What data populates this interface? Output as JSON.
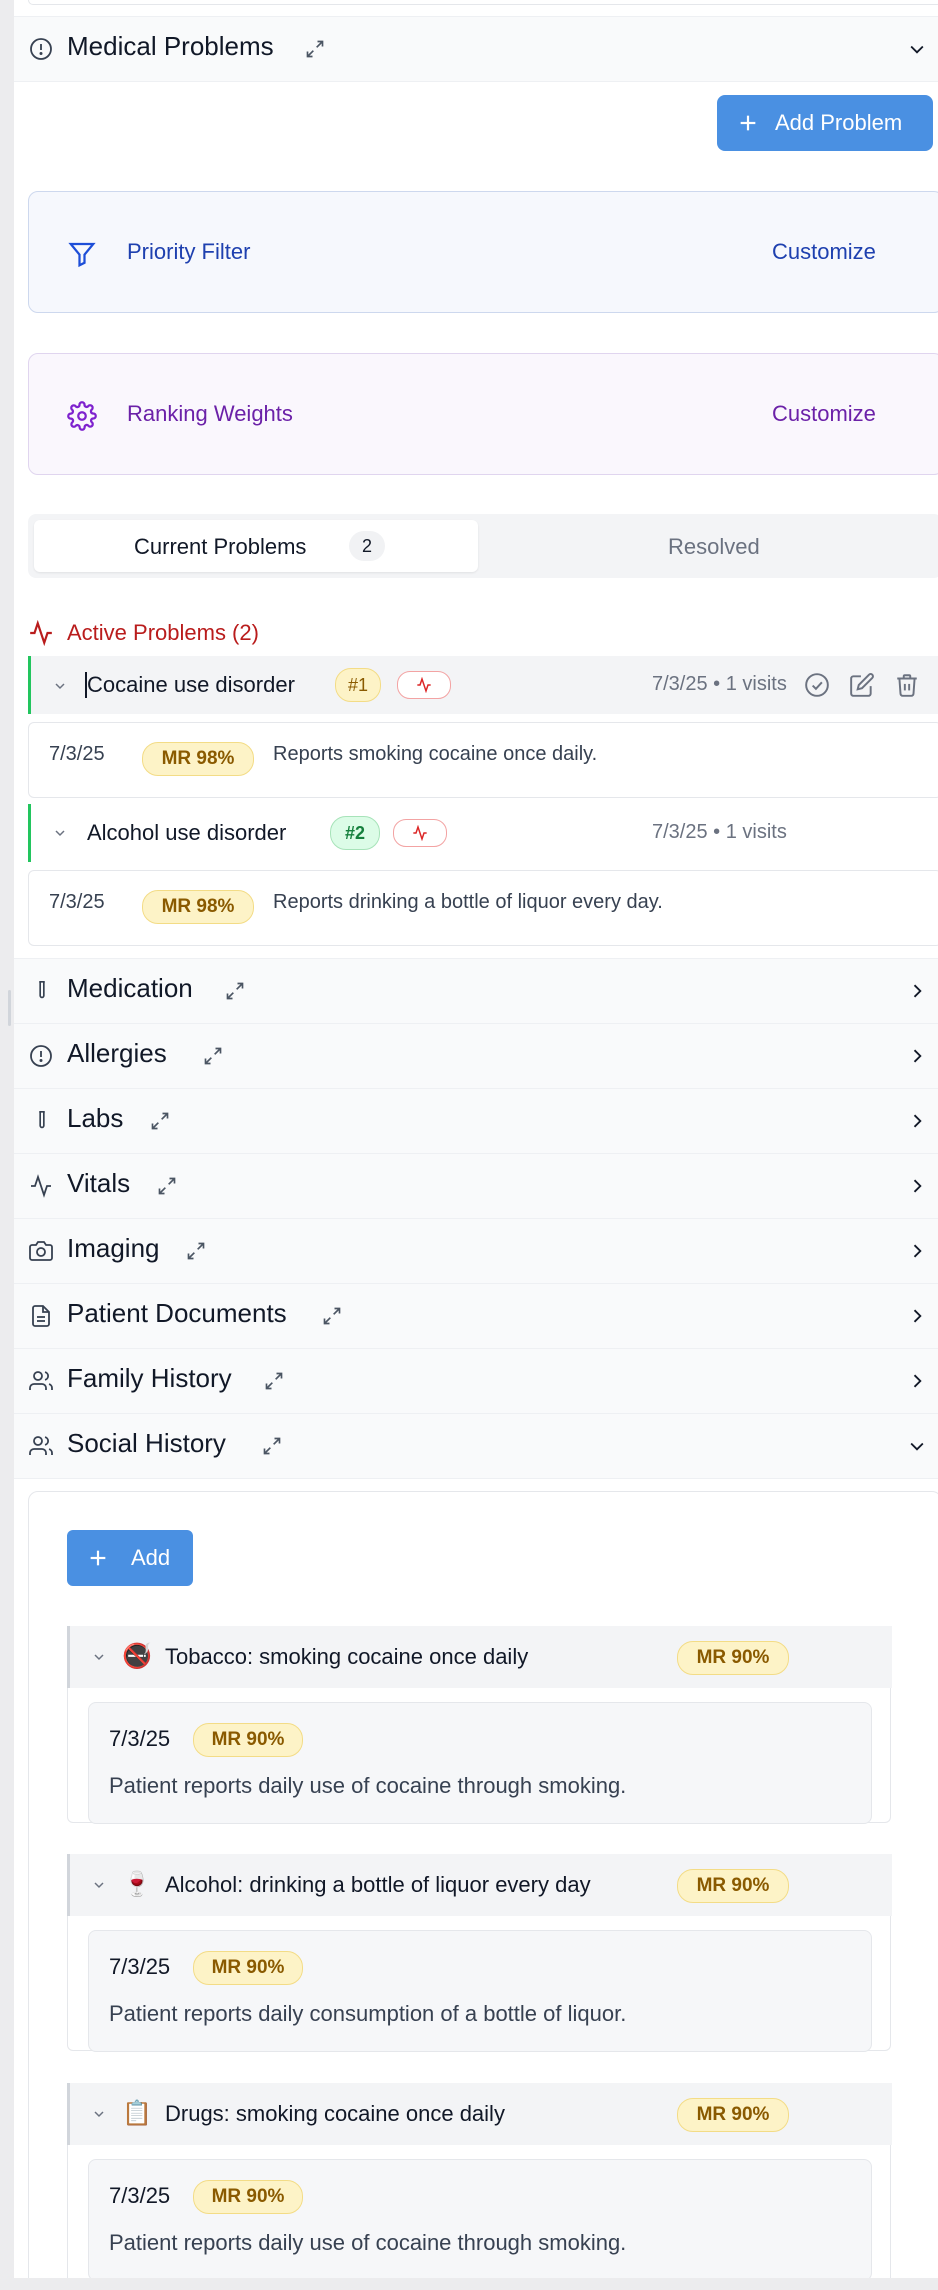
{
  "medical_problems": {
    "title": "Medical Problems",
    "add_problem_label": "Add Problem",
    "priority_filter": {
      "label": "Priority Filter",
      "action": "Customize"
    },
    "ranking_weights": {
      "label": "Ranking Weights",
      "action": "Customize"
    },
    "tabs": {
      "current_label": "Current Problems",
      "current_count": "2",
      "resolved_label": "Resolved"
    },
    "active_header": "Active Problems (2)",
    "problems": [
      {
        "name": "Cocaine use disorder",
        "rank": "#1",
        "meta": "7/3/25 • 1 visits",
        "entry": {
          "date": "7/3/25",
          "badge": "MR 98%",
          "text": "Reports smoking cocaine once daily."
        }
      },
      {
        "name": "Alcohol use disorder",
        "rank": "#2",
        "meta": "7/3/25 • 1 visits",
        "entry": {
          "date": "7/3/25",
          "badge": "MR 98%",
          "text": "Reports drinking a bottle of liquor every day."
        }
      }
    ]
  },
  "sections": [
    {
      "title": "Medication",
      "icon": "test-tube-icon"
    },
    {
      "title": "Allergies",
      "icon": "alert-circle-icon"
    },
    {
      "title": "Labs",
      "icon": "test-tube-icon"
    },
    {
      "title": "Vitals",
      "icon": "activity-icon"
    },
    {
      "title": "Imaging",
      "icon": "camera-icon"
    },
    {
      "title": "Patient Documents",
      "icon": "document-icon"
    },
    {
      "title": "Family History",
      "icon": "users-icon"
    }
  ],
  "social_history": {
    "title": "Social History",
    "add_label": "Add",
    "items": [
      {
        "emoji": "🚭",
        "title": "Tobacco: smoking cocaine once daily",
        "badge": "MR 90%",
        "entry": {
          "date": "7/3/25",
          "badge": "MR 90%",
          "text": "Patient reports daily use of cocaine through smoking."
        }
      },
      {
        "emoji": "🍷",
        "title": "Alcohol: drinking a bottle of liquor every day",
        "badge": "MR 90%",
        "entry": {
          "date": "7/3/25",
          "badge": "MR 90%",
          "text": "Patient reports daily consumption of a bottle of liquor."
        }
      },
      {
        "emoji": "📋",
        "title": "Drugs: smoking cocaine once daily",
        "badge": "MR 90%",
        "entry": {
          "date": "7/3/25",
          "badge": "MR 90%",
          "text": "Patient reports daily use of cocaine through smoking."
        }
      }
    ]
  },
  "colors": {
    "accent_blue": "#4a90e2",
    "active_red": "#b91c1c",
    "priority_blue": "#1e40af",
    "ranking_purple": "#6b21a8",
    "mr_badge_bg": "#fdf3c7"
  }
}
